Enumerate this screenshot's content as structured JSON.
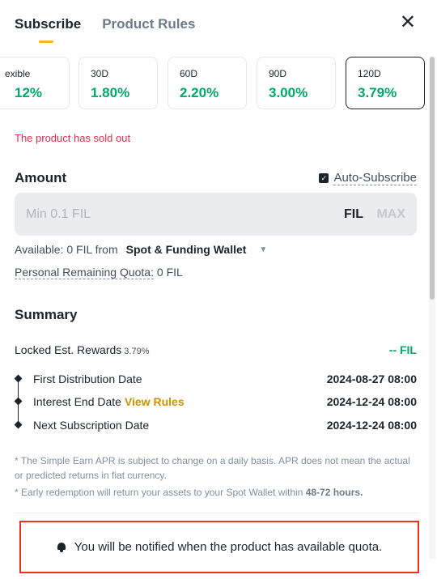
{
  "tabs": [
    {
      "label": "Subscribe",
      "active": true
    },
    {
      "label": "Product Rules",
      "active": false
    }
  ],
  "close_icon": "close-icon",
  "durations": [
    {
      "label": "exible",
      "rate": "12%"
    },
    {
      "label": "30D",
      "rate": "1.80%"
    },
    {
      "label": "60D",
      "rate": "2.20%"
    },
    {
      "label": "90D",
      "rate": "3.00%"
    },
    {
      "label": "120D",
      "rate": "3.79%",
      "selected": true
    }
  ],
  "sold_out": "The product has sold out",
  "amount": {
    "title": "Amount",
    "auto_subscribe": "Auto-Subscribe",
    "auto_subscribe_checked": true,
    "placeholder": "Min 0.1 FIL",
    "value": "",
    "unit": "FIL",
    "max": "MAX",
    "available_label": "Available: 0 FIL from",
    "wallet": "Spot & Funding Wallet",
    "quota_label": "Personal Remaining Quota:",
    "quota_value": "0 FIL"
  },
  "summary": {
    "title": "Summary",
    "rewards_label": "Locked Est. Rewards",
    "rewards_pct": "3.79%",
    "rewards_value": "-- FIL",
    "timeline": [
      {
        "label": "First Distribution Date",
        "link": "",
        "value": "2024-08-27 08:00"
      },
      {
        "label": "Interest End Date",
        "link": "View Rules",
        "value": "2024-12-24 08:00"
      },
      {
        "label": "Next Subscription Date",
        "link": "",
        "value": "2024-12-24 08:00"
      }
    ],
    "notes": [
      {
        "text": "* The Simple Earn APR is subject to change on a daily basis. APR does not mean the actual or predicted returns in fiat currency.",
        "bold": ""
      },
      {
        "text": "* Early redemption will return your assets to your Spot Wallet within ",
        "bold": "48-72 hours."
      }
    ]
  },
  "notify": {
    "icon": "bell-icon",
    "text": "You will be notified when the product has available quota."
  },
  "colors": {
    "accent": "#f0b90b",
    "green": "#03a66d",
    "red": "#d9304e",
    "link": "#c99400",
    "highlight_border": "#e8341f"
  }
}
